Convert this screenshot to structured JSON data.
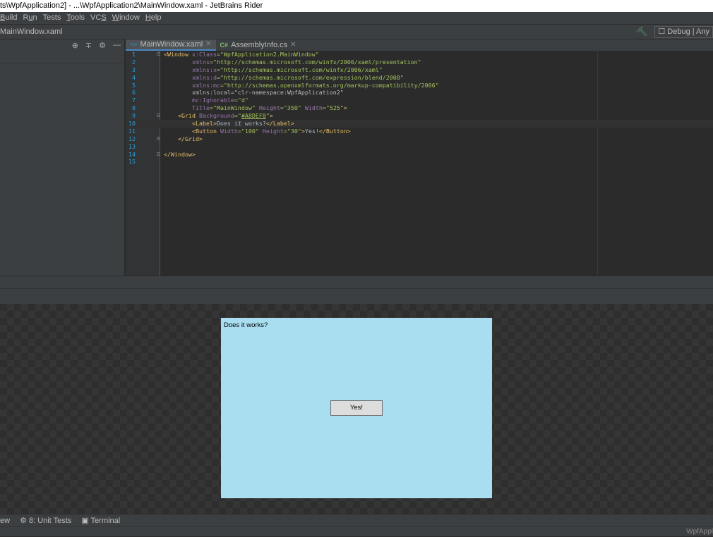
{
  "window": {
    "title": "ts\\WpfApplication2] - ...\\WpfApplication2\\MainWindow.xaml - JetBrains Rider"
  },
  "menu": {
    "items": [
      {
        "label": "Build",
        "underline": "B"
      },
      {
        "label": "Run",
        "underline": "u"
      },
      {
        "label": "Tests",
        "underline": ""
      },
      {
        "label": "Tools",
        "underline": "T"
      },
      {
        "label": "VCS",
        "underline": "S"
      },
      {
        "label": "Window",
        "underline": "W"
      },
      {
        "label": "Help",
        "underline": "H"
      }
    ]
  },
  "navbar": {
    "crumb": "MainWindow.xaml",
    "build_icon": "hammer-icon",
    "config_label": "Debug | Any"
  },
  "left_toolbar": {
    "icons": [
      "target-icon",
      "collapse-icon",
      "gear-icon",
      "minimize-icon"
    ]
  },
  "tabs": [
    {
      "label": "MainWindow.xaml",
      "icon": "xaml-file-icon",
      "active": true
    },
    {
      "label": "AssemblyInfo.cs",
      "icon": "csharp-file-icon",
      "active": false
    }
  ],
  "editor": {
    "current_line": 10,
    "lines": [
      {
        "n": "1",
        "fold": "⊟",
        "html": "<span class='tag'>&lt;Window </span><span class='attr2'>x:Class</span><span class='val'>=\"WpfApplication2.MainWindow\"</span>"
      },
      {
        "n": "2",
        "fold": "",
        "html": "        <span class='attr2'>xmlns</span><span class='val'>=\"http://schemas.microsoft.com/winfx/2006/xaml/presentation\"</span>"
      },
      {
        "n": "3",
        "fold": "",
        "html": "        <span class='attr2'>xmlns:x</span><span class='val'>=\"http://schemas.microsoft.com/winfx/2006/xaml\"</span>"
      },
      {
        "n": "4",
        "fold": "",
        "html": "        <span class='attr2'>xmlns:d</span><span class='val'>=\"http://schemas.microsoft.com/expression/blend/2008\"</span>"
      },
      {
        "n": "5",
        "fold": "",
        "html": "        <span class='attr2'>xmlns:mc</span><span class='val'>=\"http://schemas.openxmlformats.org/markup-compatibility/2006\"</span>"
      },
      {
        "n": "6",
        "fold": "",
        "html": "        <span class='attr'>xmlns:local=\"clr-namespace:WpfApplication2\"</span>"
      },
      {
        "n": "7",
        "fold": "",
        "html": "        <span class='attr2'>mc:Ignorable</span><span class='val'>=\"d\"</span>"
      },
      {
        "n": "8",
        "fold": "",
        "html": "        <span class='attr2'>Title</span><span class='val'>=\"MainWindow\" </span><span class='attr2'>Height</span><span class='val'>=\"350\" </span><span class='attr2'>Width</span><span class='val'>=\"525\"</span><span class='tag'>&gt;</span>"
      },
      {
        "n": "9",
        "fold": "⊟",
        "html": "    <span class='tag'>&lt;Grid </span><span class='attr2'>Background</span><span class='val'>=\"<u>#A8DEF0</u>\"</span><span class='tag'>&gt;</span>"
      },
      {
        "n": "10",
        "fold": "",
        "html": "        <span class='tag'>&lt;Label&gt;</span><span class='txt'>Does i⌶ works?</span><span class='tag'>&lt;/Label&gt;</span>"
      },
      {
        "n": "11",
        "fold": "",
        "html": "        <span class='tag'>&lt;Button </span><span class='attr2'>Width</span><span class='val'>=\"100\" </span><span class='attr2'>Height</span><span class='val'>=\"30\"</span><span class='tag'>&gt;</span><span class='txt'>Yes!</span><span class='tag'>&lt;/Button&gt;</span>"
      },
      {
        "n": "12",
        "fold": "⊟",
        "html": "    <span class='tag'>&lt;/Grid&gt;</span>"
      },
      {
        "n": "13",
        "fold": "",
        "html": ""
      },
      {
        "n": "14",
        "fold": "⊟",
        "html": "<span class='tag'>&lt;/Window&gt;</span>"
      },
      {
        "n": "15",
        "fold": "",
        "html": ""
      }
    ]
  },
  "designer": {
    "background_color": "#a8def0",
    "label_text": "Does it works?",
    "button_text": "Yes!"
  },
  "bottom_tabs": [
    {
      "label": "ew",
      "icon": ""
    },
    {
      "label": "8: Unit Tests",
      "icon": "unit-tests-icon"
    },
    {
      "label": "Terminal",
      "icon": "terminal-icon"
    }
  ],
  "status": {
    "right_text": "WpfAppl"
  }
}
